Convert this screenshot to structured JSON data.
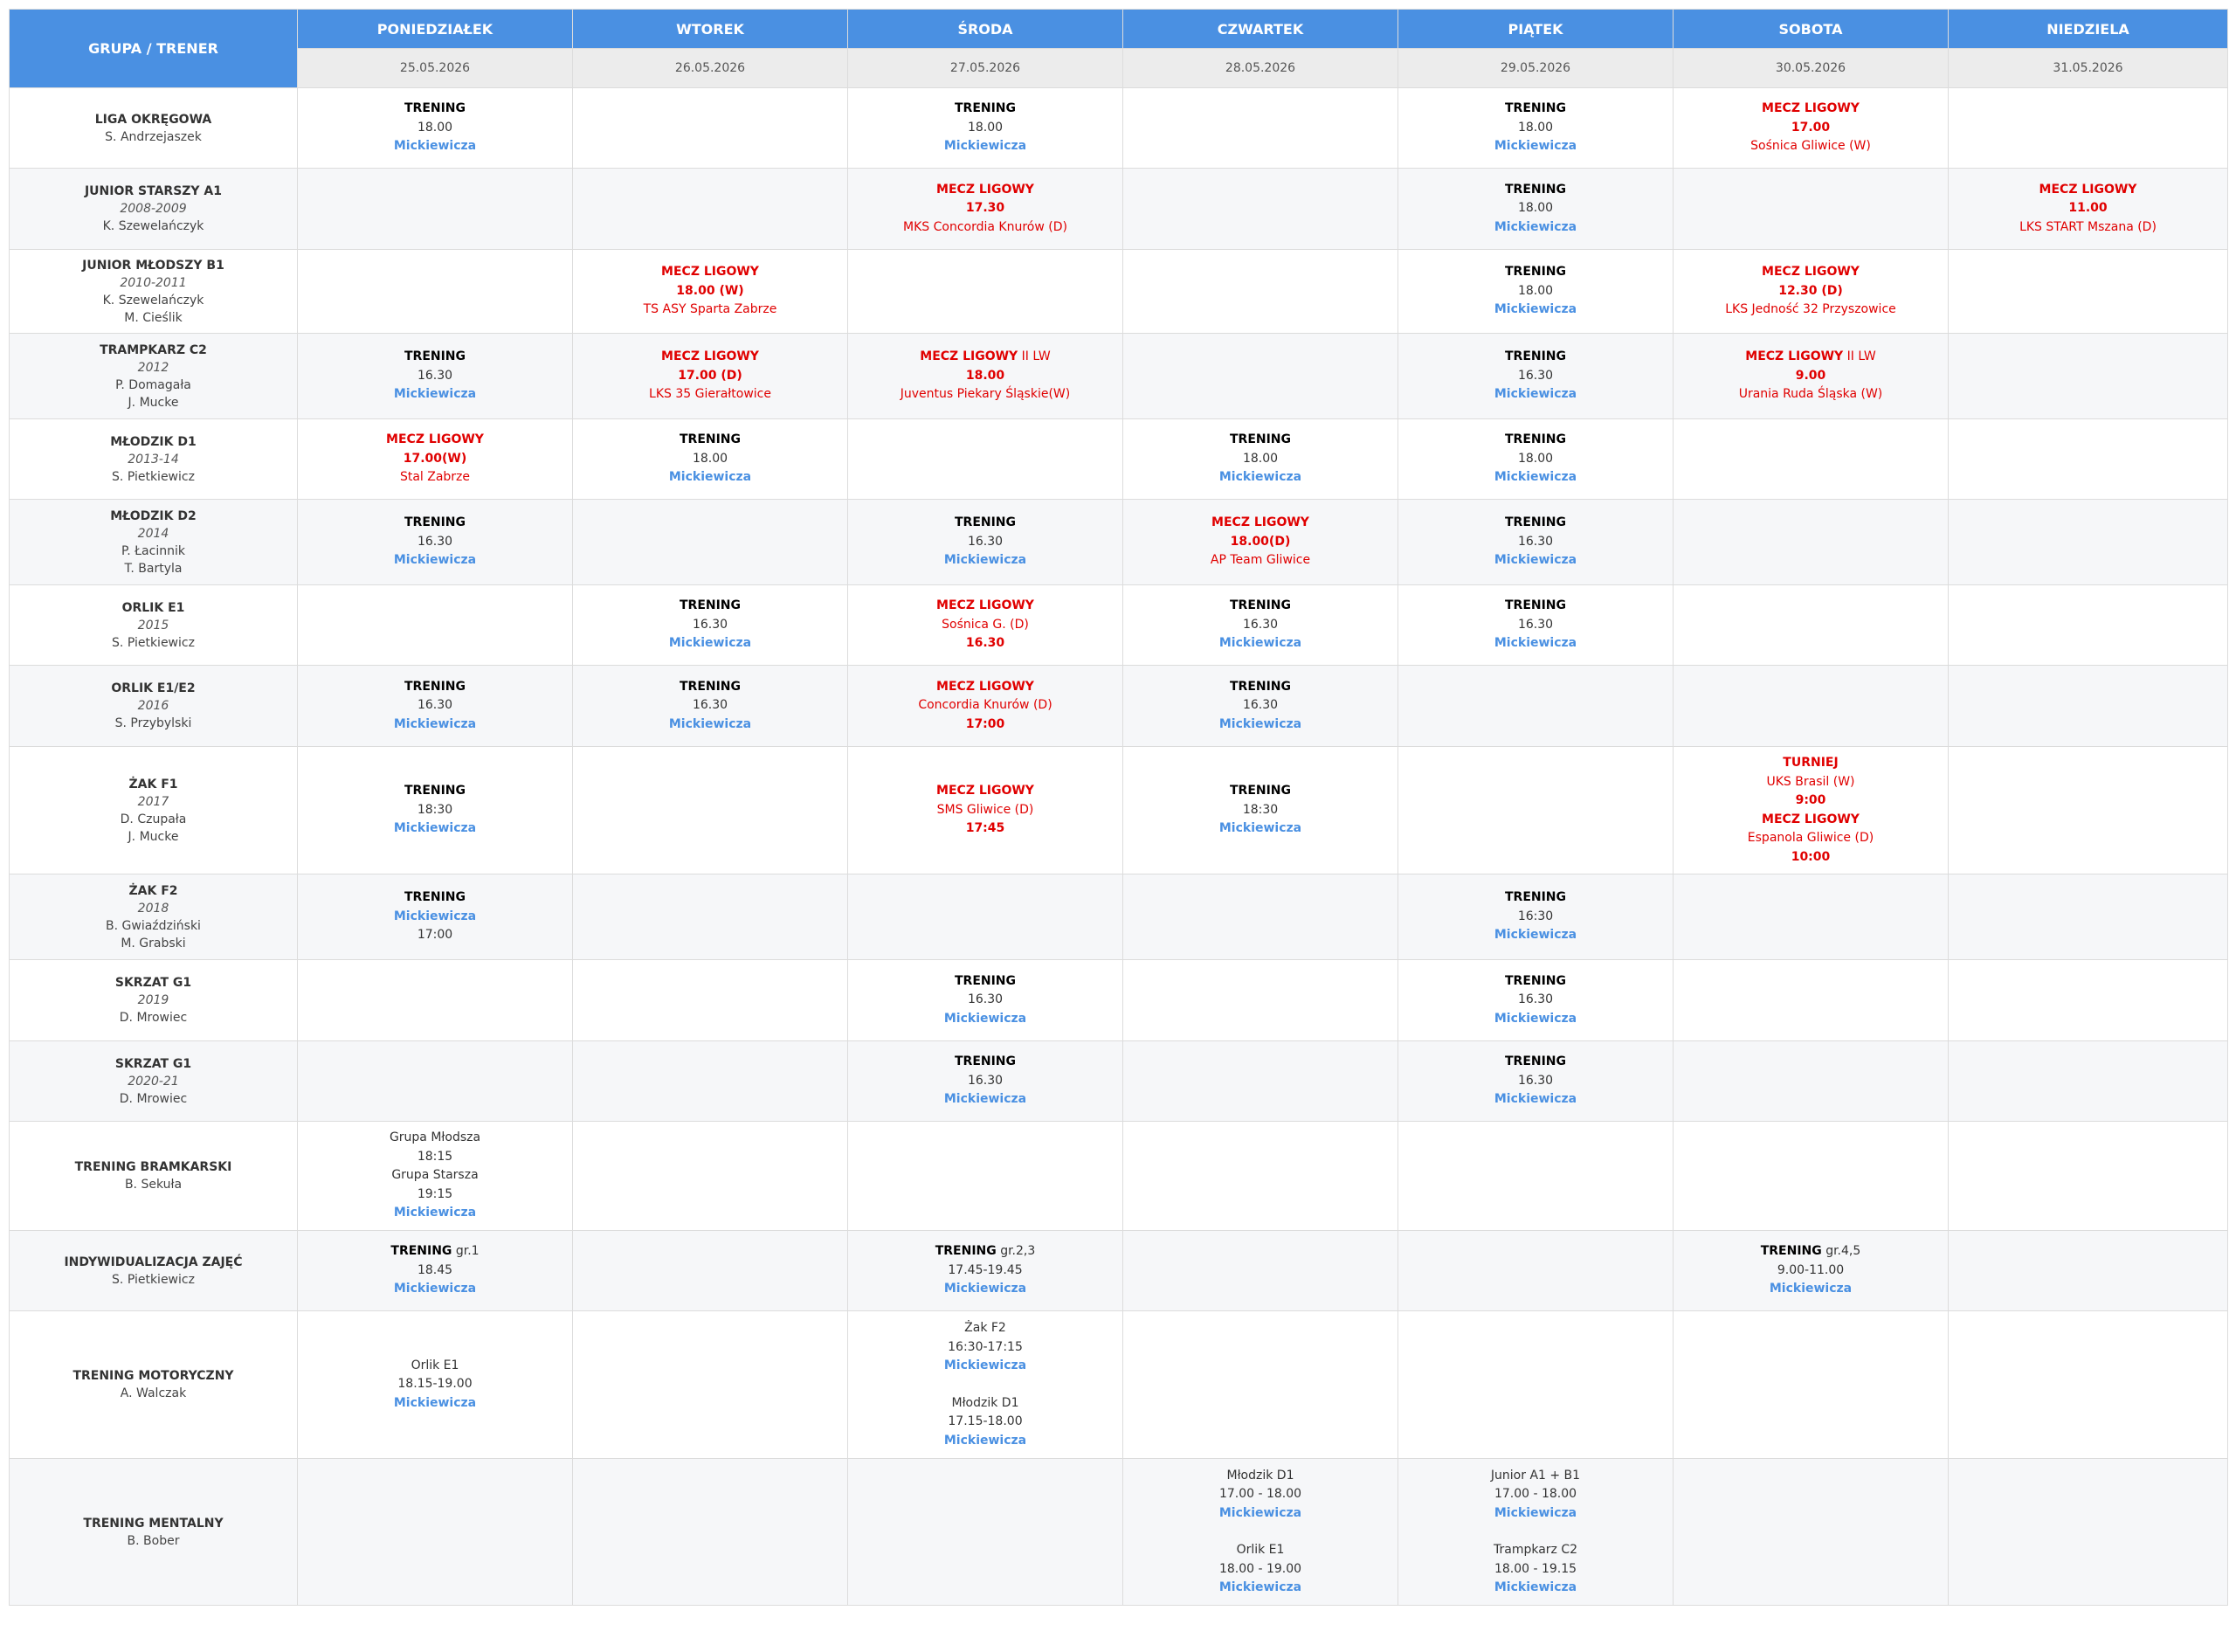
{
  "header": {
    "corner": "GRUPA / TRENER",
    "days": [
      {
        "name": "PONIEDZIAŁEK",
        "date": "25.05.2026"
      },
      {
        "name": "WTOREK",
        "date": "26.05.2026"
      },
      {
        "name": "ŚRODA",
        "date": "27.05.2026"
      },
      {
        "name": "CZWARTEK",
        "date": "28.05.2026"
      },
      {
        "name": "PIĄTEK",
        "date": "29.05.2026"
      },
      {
        "name": "SOBOTA",
        "date": "30.05.2026"
      },
      {
        "name": "NIEDZIELA",
        "date": "31.05.2026"
      }
    ]
  },
  "colors": {
    "header_blue": "#4a90e2",
    "location_blue": "#4a90e2",
    "match_red": "#e00000",
    "alt_row": "#f6f7f9",
    "date_row": "#ececec"
  },
  "rows": [
    {
      "h": 92,
      "group": [
        "LIGA OKRĘGOWA"
      ],
      "year": "",
      "trainers": [
        "S. Andrzejaszek"
      ],
      "cells": [
        [
          [
            "t",
            "TRENING"
          ],
          [
            "tx",
            "18.00"
          ],
          [
            "loc",
            "Mickiewicza"
          ]
        ],
        [],
        [
          [
            "t",
            "TRENING"
          ],
          [
            "tx",
            "18.00"
          ],
          [
            "loc",
            "Mickiewicza"
          ]
        ],
        [],
        [
          [
            "t",
            "TRENING"
          ],
          [
            "tx",
            "18.00"
          ],
          [
            "loc",
            "Mickiewicza"
          ]
        ],
        [
          [
            "m",
            "MECZ LIGOWY"
          ],
          [
            "mb",
            "17.00"
          ],
          [
            "red",
            "Sośnica Gliwice (W)"
          ]
        ],
        []
      ]
    },
    {
      "h": 93,
      "group": [
        "JUNIOR STARSZY A1"
      ],
      "year": "2008-2009",
      "trainers": [
        "K. Szewelańczyk"
      ],
      "cells": [
        [],
        [],
        [
          [
            "m",
            "MECZ LIGOWY"
          ],
          [
            "mb",
            "17.30"
          ],
          [
            "red",
            "MKS Concordia Knurów (D)"
          ]
        ],
        [],
        [
          [
            "t",
            "TRENING"
          ],
          [
            "tx",
            "18.00"
          ],
          [
            "loc",
            "Mickiewicza"
          ]
        ],
        [],
        [
          [
            "m",
            "MECZ LIGOWY"
          ],
          [
            "mb",
            "11.00"
          ],
          [
            "red",
            "LKS START Mszana (D)"
          ]
        ]
      ]
    },
    {
      "h": 96,
      "group": [
        "JUNIOR MŁODSZY B1"
      ],
      "year": "2010-2011",
      "trainers": [
        "K. Szewelańczyk",
        "M. Cieślik"
      ],
      "cells": [
        [],
        [
          [
            "m",
            "MECZ LIGOWY"
          ],
          [
            "mb",
            "18.00 (W)"
          ],
          [
            "red",
            "TS ASY Sparta Zabrze"
          ]
        ],
        [],
        [],
        [
          [
            "t",
            "TRENING"
          ],
          [
            "tx",
            "18.00"
          ],
          [
            "loc",
            "Mickiewicza"
          ]
        ],
        [
          [
            "m",
            "MECZ LIGOWY"
          ],
          [
            "mb",
            "12.30 (D)"
          ],
          [
            "red",
            "LKS Jedność 32 Przyszowice"
          ]
        ],
        []
      ]
    },
    {
      "h": 98,
      "group": [
        "TRAMPKARZ C2"
      ],
      "year": "2012",
      "trainers": [
        "P. Domagała",
        "J. Mucke"
      ],
      "cells": [
        [
          [
            "t",
            "TRENING"
          ],
          [
            "tx",
            "16.30"
          ],
          [
            "loc",
            "Mickiewicza"
          ]
        ],
        [
          [
            "m",
            "MECZ LIGOWY"
          ],
          [
            "mb",
            "17.00 (D)"
          ],
          [
            "red",
            "LKS 35 Gierałtowice"
          ]
        ],
        [
          [
            "ms",
            "MECZ LIGOWY",
            "II LW"
          ],
          [
            "mb",
            "18.00"
          ],
          [
            "red",
            "Juventus Piekary Śląskie(W)"
          ]
        ],
        [],
        [
          [
            "t",
            "TRENING"
          ],
          [
            "tx",
            "16.30"
          ],
          [
            "loc",
            "Mickiewicza"
          ]
        ],
        [
          [
            "ms",
            "MECZ LIGOWY",
            "II LW"
          ],
          [
            "mb",
            "9.00"
          ],
          [
            "red",
            "Urania Ruda Śląska (W)"
          ]
        ],
        []
      ]
    },
    {
      "h": 92,
      "group": [
        "MŁODZIK D1"
      ],
      "year": "2013-14",
      "trainers": [
        "S. Pietkiewicz"
      ],
      "cells": [
        [
          [
            "m",
            "MECZ LIGOWY"
          ],
          [
            "mb",
            "17.00(W)"
          ],
          [
            "red",
            "Stal Zabrze"
          ]
        ],
        [
          [
            "t",
            "TRENING"
          ],
          [
            "tx",
            "18.00"
          ],
          [
            "loc",
            "Mickiewicza"
          ]
        ],
        [],
        [
          [
            "t",
            "TRENING"
          ],
          [
            "tx",
            "18.00"
          ],
          [
            "loc",
            "Mickiewicza"
          ]
        ],
        [
          [
            "t",
            "TRENING"
          ],
          [
            "tx",
            "18.00"
          ],
          [
            "loc",
            "Mickiewicza"
          ]
        ],
        [],
        []
      ]
    },
    {
      "h": 98,
      "group": [
        "MŁODZIK D2"
      ],
      "year": "2014",
      "trainers": [
        "P. Łacinnik",
        "T. Bartyla"
      ],
      "cells": [
        [
          [
            "t",
            "TRENING"
          ],
          [
            "tx",
            "16.30"
          ],
          [
            "loc",
            "Mickiewicza"
          ]
        ],
        [],
        [
          [
            "t",
            "TRENING"
          ],
          [
            "tx",
            "16.30"
          ],
          [
            "loc",
            "Mickiewicza"
          ]
        ],
        [
          [
            "m",
            "MECZ LIGOWY"
          ],
          [
            "mb",
            "18.00(D)"
          ],
          [
            "red",
            "AP Team Gliwice"
          ]
        ],
        [
          [
            "t",
            "TRENING"
          ],
          [
            "tx",
            "16.30"
          ],
          [
            "loc",
            "Mickiewicza"
          ]
        ],
        [],
        []
      ]
    },
    {
      "h": 92,
      "group": [
        "ORLIK E1"
      ],
      "year": "2015",
      "trainers": [
        "S. Pietkiewicz"
      ],
      "cells": [
        [],
        [
          [
            "t",
            "TRENING"
          ],
          [
            "tx",
            "16.30"
          ],
          [
            "loc",
            "Mickiewicza"
          ]
        ],
        [
          [
            "m",
            "MECZ LIGOWY"
          ],
          [
            "red",
            "Sośnica G. (D)"
          ],
          [
            "mb",
            "16.30"
          ]
        ],
        [
          [
            "t",
            "TRENING"
          ],
          [
            "tx",
            "16.30"
          ],
          [
            "loc",
            "Mickiewicza"
          ]
        ],
        [
          [
            "t",
            "TRENING"
          ],
          [
            "tx",
            "16.30"
          ],
          [
            "loc",
            "Mickiewicza"
          ]
        ],
        [],
        []
      ]
    },
    {
      "h": 93,
      "group": [
        "ORLIK E1/E2"
      ],
      "year": "2016",
      "trainers": [
        "S. Przybylski"
      ],
      "cells": [
        [
          [
            "t",
            "TRENING"
          ],
          [
            "tx",
            "16.30"
          ],
          [
            "loc",
            "Mickiewicza"
          ]
        ],
        [
          [
            "t",
            "TRENING"
          ],
          [
            "tx",
            "16.30"
          ],
          [
            "loc",
            "Mickiewicza"
          ]
        ],
        [
          [
            "m",
            "MECZ LIGOWY"
          ],
          [
            "red",
            "Concordia Knurów (D)"
          ],
          [
            "mb",
            "17:00"
          ]
        ],
        [
          [
            "t",
            "TRENING"
          ],
          [
            "tx",
            "16.30"
          ],
          [
            "loc",
            "Mickiewicza"
          ]
        ],
        [],
        [],
        []
      ]
    },
    {
      "h": 146,
      "group": [
        "ŻAK F1"
      ],
      "year": "2017",
      "trainers": [
        "D. Czupała",
        "J. Mucke"
      ],
      "cells": [
        [
          [
            "t",
            "TRENING"
          ],
          [
            "tx",
            "18:30"
          ],
          [
            "loc",
            "Mickiewicza"
          ]
        ],
        [],
        [
          [
            "m",
            "MECZ LIGOWY"
          ],
          [
            "red",
            "SMS Gliwice (D)"
          ],
          [
            "mb",
            "17:45"
          ]
        ],
        [
          [
            "t",
            "TRENING"
          ],
          [
            "tx",
            "18:30"
          ],
          [
            "loc",
            "Mickiewicza"
          ]
        ],
        [],
        [
          [
            "m",
            "TURNIEJ"
          ],
          [
            "red",
            "UKS Brasil (W)"
          ],
          [
            "mb",
            "9:00"
          ],
          [
            "m",
            "MECZ LIGOWY"
          ],
          [
            "red",
            "Espanola Gliwice (D)"
          ],
          [
            "mb",
            "10:00"
          ]
        ],
        []
      ]
    },
    {
      "h": 98,
      "group": [
        "ŻAK F2"
      ],
      "year": "2018",
      "trainers": [
        "B. Gwiaździński",
        "M. Grabski"
      ],
      "cells": [
        [
          [
            "t",
            "TRENING"
          ],
          [
            "loc",
            "Mickiewicza"
          ],
          [
            "tx",
            "17:00"
          ]
        ],
        [],
        [],
        [],
        [
          [
            "t",
            "TRENING"
          ],
          [
            "tx",
            "16:30"
          ],
          [
            "loc",
            "Mickiewicza"
          ]
        ],
        [],
        []
      ]
    },
    {
      "h": 93,
      "group": [
        "SKRZAT G1"
      ],
      "year": "2019",
      "trainers": [
        "D. Mrowiec"
      ],
      "cells": [
        [],
        [],
        [
          [
            "t",
            "TRENING"
          ],
          [
            "tx",
            "16.30"
          ],
          [
            "loc",
            "Mickiewicza"
          ]
        ],
        [],
        [
          [
            "t",
            "TRENING"
          ],
          [
            "tx",
            "16.30"
          ],
          [
            "loc",
            "Mickiewicza"
          ]
        ],
        [],
        []
      ]
    },
    {
      "h": 92,
      "group": [
        "SKRZAT G1"
      ],
      "year": "2020-21",
      "trainers": [
        "D. Mrowiec"
      ],
      "cells": [
        [],
        [],
        [
          [
            "t",
            "TRENING"
          ],
          [
            "tx",
            "16.30"
          ],
          [
            "loc",
            "Mickiewicza"
          ]
        ],
        [],
        [
          [
            "t",
            "TRENING"
          ],
          [
            "tx",
            "16.30"
          ],
          [
            "loc",
            "Mickiewicza"
          ]
        ],
        [],
        []
      ]
    },
    {
      "h": 125,
      "group": [
        "TRENING BRAMKARSKI"
      ],
      "year": "",
      "trainers": [
        "B. Sekuła"
      ],
      "cells": [
        [
          [
            "tx",
            "Grupa Młodsza"
          ],
          [
            "tx",
            "18:15"
          ],
          [
            "tx",
            "Grupa Starsza"
          ],
          [
            "tx",
            "19:15"
          ],
          [
            "loc",
            "Mickiewicza"
          ]
        ],
        [],
        [],
        [],
        [],
        [],
        []
      ]
    },
    {
      "h": 92,
      "group": [
        "INDYWIDUALIZACJA ZAJĘĆ"
      ],
      "year": "",
      "trainers": [
        "S. Pietkiewicz"
      ],
      "cells": [
        [
          [
            "ts",
            "TRENING",
            "gr.1"
          ],
          [
            "tx",
            "18.45"
          ],
          [
            "loc",
            "Mickiewicza"
          ]
        ],
        [],
        [
          [
            "ts",
            "TRENING",
            "gr.2,3"
          ],
          [
            "tx",
            "17.45-19.45"
          ],
          [
            "loc",
            "Mickiewicza"
          ]
        ],
        [],
        [],
        [
          [
            "ts",
            "TRENING",
            "gr.4,5"
          ],
          [
            "tx",
            "9.00-11.00"
          ],
          [
            "loc",
            "Mickiewicza"
          ]
        ],
        []
      ]
    },
    {
      "h": 169,
      "group": [
        "TRENING MOTORYCZNY"
      ],
      "year": "",
      "trainers": [
        "A. Walczak"
      ],
      "cells": [
        [
          [
            "tx",
            "Orlik E1"
          ],
          [
            "tx",
            "18.15-19.00"
          ],
          [
            "loc",
            "Mickiewicza"
          ]
        ],
        [],
        [
          [
            "tx",
            "Żak F2"
          ],
          [
            "tx",
            "16:30-17:15"
          ],
          [
            "loc",
            "Mickiewicza"
          ],
          [
            "gap",
            ""
          ],
          [
            "tx",
            "Młodzik D1"
          ],
          [
            "tx",
            "17.15-18.00"
          ],
          [
            "loc",
            "Mickiewicza"
          ]
        ],
        [],
        [],
        [],
        []
      ]
    },
    {
      "h": 168,
      "group": [
        "TRENING MENTALNY"
      ],
      "year": "",
      "trainers": [
        "B. Bober"
      ],
      "cells": [
        [],
        [],
        [],
        [
          [
            "tx",
            "Młodzik D1"
          ],
          [
            "tx",
            "17.00 - 18.00"
          ],
          [
            "loc",
            "Mickiewicza"
          ],
          [
            "gap",
            ""
          ],
          [
            "tx",
            "Orlik E1"
          ],
          [
            "tx",
            "18.00 - 19.00"
          ],
          [
            "loc",
            "Mickiewicza"
          ]
        ],
        [
          [
            "tx",
            "Junior A1 + B1"
          ],
          [
            "tx",
            "17.00 - 18.00"
          ],
          [
            "loc",
            "Mickiewicza"
          ],
          [
            "gap",
            ""
          ],
          [
            "tx",
            "Trampkarz C2"
          ],
          [
            "tx",
            "18.00 - 19.15"
          ],
          [
            "loc",
            "Mickiewicza"
          ]
        ],
        [],
        []
      ]
    }
  ]
}
